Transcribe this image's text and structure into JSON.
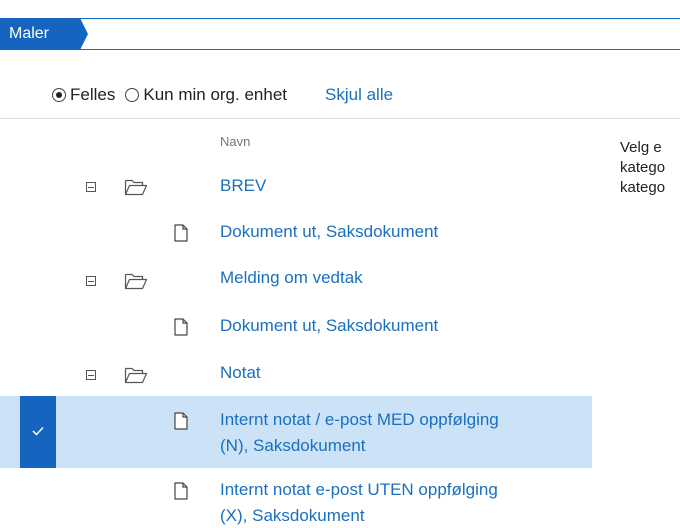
{
  "breadcrumb": {
    "label": "Maler"
  },
  "filter": {
    "options": [
      {
        "label": "Felles",
        "checked": true
      },
      {
        "label": "Kun min org. enhet",
        "checked": false
      }
    ],
    "toggle_label": "Skjul alle"
  },
  "list": {
    "column_header": "Navn",
    "rows": [
      {
        "type": "folder",
        "label": "BREV"
      },
      {
        "type": "document",
        "label": "Dokument ut, Saksdokument"
      },
      {
        "type": "folder",
        "label": "Melding om vedtak"
      },
      {
        "type": "document",
        "label": "Dokument ut, Saksdokument"
      },
      {
        "type": "folder",
        "label": "Notat"
      },
      {
        "type": "document",
        "label_line1": "Internt notat / e-post MED oppfølging",
        "label_line2": "(N), Saksdokument",
        "selected": true
      },
      {
        "type": "document",
        "label_line1": "Internt notat e-post UTEN oppfølging",
        "label_line2": "(X), Saksdokument"
      }
    ]
  },
  "side_panel": {
    "line1": "Velg e",
    "line2": "katego",
    "line3": "katego"
  },
  "colors": {
    "accent": "#1565c0",
    "link": "#1a6fc0",
    "selected_row": "#cce3f7"
  }
}
